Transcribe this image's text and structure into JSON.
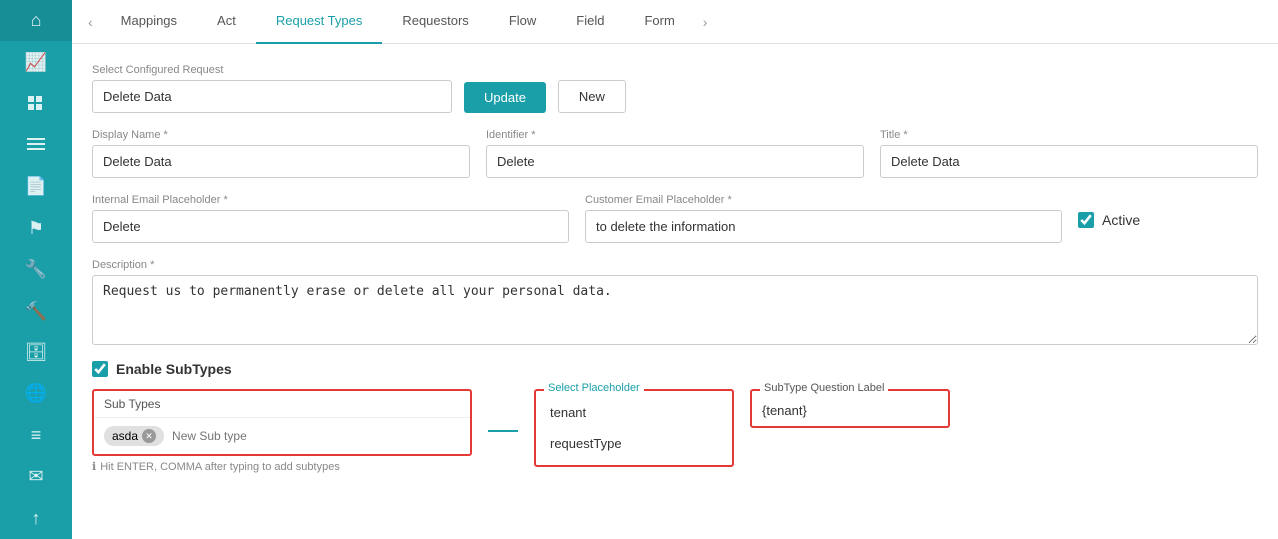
{
  "sidebar": {
    "items": [
      {
        "name": "home-icon",
        "icon": "⌂"
      },
      {
        "name": "chart-icon",
        "icon": "📊"
      },
      {
        "name": "grid-icon",
        "icon": "▦"
      },
      {
        "name": "table-icon",
        "icon": "☰"
      },
      {
        "name": "document-icon",
        "icon": "📄"
      },
      {
        "name": "flag-icon",
        "icon": "⚑"
      },
      {
        "name": "tools-icon",
        "icon": "🔧"
      },
      {
        "name": "hammer-icon",
        "icon": "🔨"
      },
      {
        "name": "storage-icon",
        "icon": "🗄"
      },
      {
        "name": "globe-icon",
        "icon": "🌐"
      },
      {
        "name": "list-icon",
        "icon": "≡"
      },
      {
        "name": "mail-icon",
        "icon": "✉"
      },
      {
        "name": "upload-icon",
        "icon": "↑"
      }
    ]
  },
  "tabs": {
    "items": [
      {
        "label": "Mappings",
        "active": false
      },
      {
        "label": "Act",
        "active": false
      },
      {
        "label": "Request Types",
        "active": true
      },
      {
        "label": "Requestors",
        "active": false
      },
      {
        "label": "Flow",
        "active": false
      },
      {
        "label": "Field",
        "active": false
      },
      {
        "label": "Form",
        "active": false
      }
    ],
    "prev_arrow": "‹",
    "next_arrow": "›"
  },
  "form": {
    "select_configured_request": {
      "label": "Select Configured Request",
      "value": "Delete Data"
    },
    "buttons": {
      "update": "Update",
      "new": "New"
    },
    "display_name": {
      "label": "Display Name *",
      "value": "Delete Data"
    },
    "identifier": {
      "label": "Identifier *",
      "value": "Delete"
    },
    "title": {
      "label": "Title *",
      "value": "Delete Data"
    },
    "internal_email_placeholder": {
      "label": "Internal Email Placeholder *",
      "value": "Delete"
    },
    "customer_email_placeholder": {
      "label": "Customer Email Placeholder *",
      "value": "to delete the information"
    },
    "active": {
      "label": "Active",
      "checked": true
    },
    "description": {
      "label": "Description *",
      "value": "Request us to permanently erase or delete all your personal data."
    },
    "enable_subtypes": {
      "label": "Enable SubTypes",
      "checked": true
    },
    "subtypes": {
      "section_label": "Sub Types",
      "tag": "asda",
      "placeholder": "New Sub type",
      "hint": "Hit ENTER, COMMA after typing to add subtypes"
    },
    "select_placeholder": {
      "label": "Select Placeholder",
      "items": [
        {
          "value": "tenant",
          "selected": false
        },
        {
          "value": "requestType",
          "selected": false
        }
      ]
    },
    "subtype_question_label": {
      "label": "SubType Question Label",
      "value": "{tenant}"
    }
  }
}
